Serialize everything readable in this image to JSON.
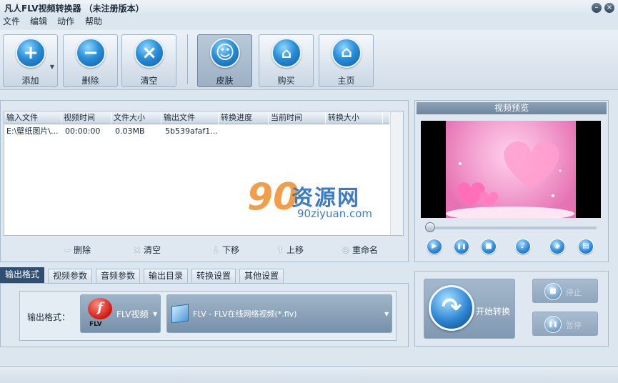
{
  "window": {
    "title": "凡人FLV视频转换器 （未注册版本）",
    "minimize_glyph": "–",
    "close_glyph": "×"
  },
  "menu": [
    "文件",
    "编辑",
    "动作",
    "帮助"
  ],
  "toolbar": {
    "buttons": [
      {
        "label": "添加",
        "icon": "plus-icon",
        "glyph": "+"
      },
      {
        "label": "删除",
        "icon": "minus-icon",
        "glyph": "−"
      },
      {
        "label": "清空",
        "icon": "clear-icon",
        "glyph": "×"
      },
      {
        "label": "皮肤",
        "icon": "smiley-icon",
        "glyph": "☺"
      },
      {
        "label": "购买",
        "icon": "cart-icon",
        "glyph": "⌂"
      },
      {
        "label": "主页",
        "icon": "home-icon",
        "glyph": "⌂"
      }
    ],
    "add_dropdown": "▼"
  },
  "file_list": {
    "columns": [
      "输入文件",
      "视频时间",
      "文件大小",
      "输出文件",
      "转换进度",
      "当前时间",
      "转换大小"
    ],
    "rows": [
      {
        "input": "E:\\壁纸图片\\...",
        "duration": "00:00:00",
        "size": "0.03MB",
        "output": "5b539afaf1...",
        "progress": "",
        "current": "",
        "converted": ""
      }
    ],
    "actions": [
      {
        "label": "删除",
        "icon": "minus-icon",
        "glyph": "−"
      },
      {
        "label": "清空",
        "icon": "clear-icon",
        "glyph": "×"
      },
      {
        "label": "下移",
        "icon": "arrow-down-icon",
        "glyph": "↓"
      },
      {
        "label": "上移",
        "icon": "arrow-up-icon",
        "glyph": "↑"
      },
      {
        "label": "重命名",
        "icon": "rename-icon",
        "glyph": "⊕"
      }
    ]
  },
  "watermark": {
    "big": "资源网",
    "small": "90ziyuan.com",
    "logo": "90"
  },
  "preview": {
    "title": "视频预览",
    "controls": [
      {
        "icon": "play-icon",
        "glyph": "▶"
      },
      {
        "icon": "pause-icon",
        "glyph": "❚❚"
      },
      {
        "icon": "stop-icon",
        "glyph": "■"
      },
      {
        "icon": "volume-icon",
        "glyph": "♪"
      },
      {
        "icon": "snapshot-icon",
        "glyph": "◉"
      },
      {
        "icon": "folder-icon",
        "glyph": "▤"
      }
    ]
  },
  "tabs": [
    "输出格式",
    "视频参数",
    "音频参数",
    "输出目录",
    "转换设置",
    "其他设置"
  ],
  "output_format": {
    "label": "输出格式：",
    "format_type": "FLV视频",
    "flash_logo": "f",
    "flash_sub": "FLV",
    "format_detail": "FLV - FLV在线网络视频(*.flv)",
    "arrow": "▼"
  },
  "convert": {
    "start_label": "开始转换",
    "start_glyph": "↷",
    "stop_label": "停止",
    "stop_glyph": "■",
    "pause_label": "暂停",
    "pause_glyph": "❚❚"
  },
  "colors": {
    "accent_blue": "#2f86d4",
    "active_tab": "#2e4f72",
    "watermark_orange": "#f08c2a",
    "watermark_blue": "#3d7bc4"
  }
}
